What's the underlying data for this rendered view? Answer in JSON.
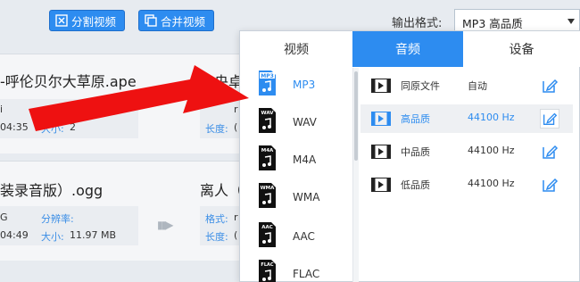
{
  "toolbar": {
    "split_label": "分割视频",
    "merge_label": "合并视频",
    "output_format_label": "输出格式:",
    "output_format_value": "MP3  高品质"
  },
  "files": [
    {
      "title": "-呼伦贝尔大草原.ape",
      "line1_left": "i",
      "line2_left": "04:35",
      "label_res": "分辨率:",
      "label_size": "大小:",
      "size_value": "2",
      "target_title": "降央卓",
      "target_line1": "r",
      "target_label_len": "长度:",
      "target_line2": "("
    },
    {
      "title": "装录音版）.ogg",
      "line1_left": "G",
      "line2_left": "04:49",
      "label_res": "分辨率:",
      "label_size": "大小:",
      "size_value": "11.97 MB",
      "target_title": "离人（",
      "target_label_fmt": "格式:",
      "target_line1": "r",
      "target_label_len": "长度:",
      "target_line2": "("
    }
  ],
  "panel": {
    "tabs": [
      "视频",
      "音频",
      "设备"
    ],
    "active_tab": "音频",
    "formats": [
      {
        "icon_text": "MP3",
        "name": "MP3",
        "selected": true
      },
      {
        "icon_text": "WAV",
        "name": "WAV",
        "selected": false
      },
      {
        "icon_text": "M4A",
        "name": "M4A",
        "selected": false
      },
      {
        "icon_text": "WMA",
        "name": "WMA",
        "selected": false
      },
      {
        "icon_text": "AAC",
        "name": "AAC",
        "selected": false
      },
      {
        "icon_text": "FLAC",
        "name": "FLAC",
        "selected": false
      }
    ],
    "qualities": [
      {
        "name": "同原文件",
        "rate": "自动",
        "selected": false
      },
      {
        "name": "高品质",
        "rate": "44100 Hz",
        "selected": true
      },
      {
        "name": "中品质",
        "rate": "44100 Hz",
        "selected": false
      },
      {
        "name": "低品质",
        "rate": "44100 Hz",
        "selected": false
      }
    ]
  },
  "colors": {
    "accent": "#2d8cf0",
    "arrow": "#ee1111",
    "background": "#e7ebf0"
  }
}
